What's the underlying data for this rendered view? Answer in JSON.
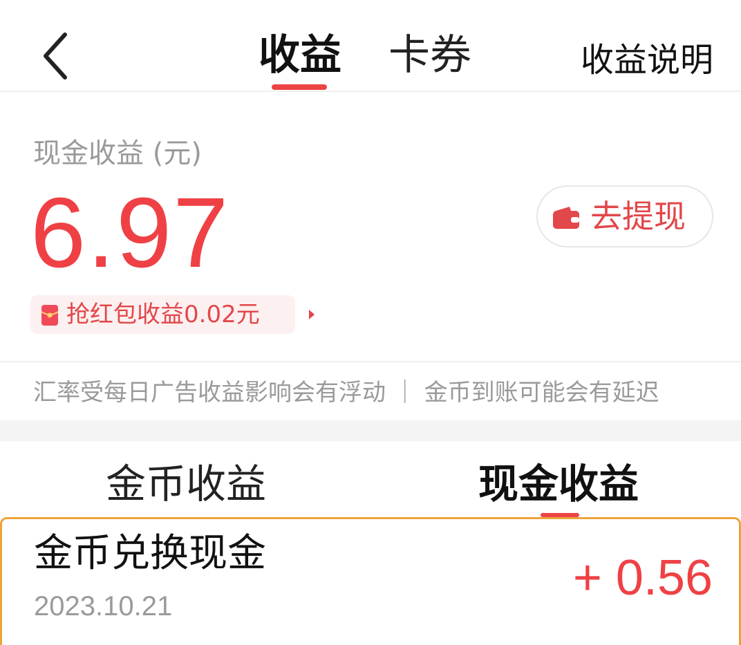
{
  "header": {
    "back_icon": "chevron-left-icon",
    "tabs": [
      {
        "label": "收益",
        "active": true
      },
      {
        "label": "卡券",
        "active": false
      }
    ],
    "help_label": "收益说明"
  },
  "balance": {
    "label": "现金收益 (元)",
    "value": "6.97",
    "withdraw_label": "去提现",
    "withdraw_icon": "wallet-icon",
    "redpacket_label": "抢红包收益0.02元",
    "redpacket_icon": "red-envelope-icon"
  },
  "notice": "汇率受每日广告收益影响会有浮动 ｜ 金币到账可能会有延迟",
  "subtabs": [
    {
      "label": "金币收益",
      "active": false
    },
    {
      "label": "现金收益",
      "active": true
    }
  ],
  "records": [
    {
      "title": "金币兑换现金",
      "date": "2023.10.21",
      "amount": "+ 0.56"
    }
  ],
  "colors": {
    "accent": "#ef4145",
    "highlight_border": "#eda33a",
    "muted_text": "#9a9a9a"
  }
}
